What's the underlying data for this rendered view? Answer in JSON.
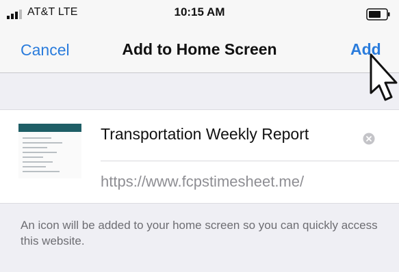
{
  "status_bar": {
    "carrier": "AT&T  LTE",
    "time": "10:15 AM"
  },
  "nav": {
    "cancel_label": "Cancel",
    "title": "Add to Home Screen",
    "add_label": "Add"
  },
  "bookmark": {
    "title": "Transportation Weekly Report",
    "url": "https://www.fcpstimesheet.me/"
  },
  "explanation": "An icon will be added to your home screen so you can quickly access this website.",
  "colors": {
    "accent": "#2a7cdc",
    "background": "#efeff4",
    "secondary_text": "#8e8e93",
    "thumbnail_header": "#1e5e66"
  },
  "icons": {
    "signal": "signal-bars-icon",
    "battery": "battery-icon",
    "clear": "clear-circle-icon",
    "cursor": "mouse-pointer-icon"
  }
}
